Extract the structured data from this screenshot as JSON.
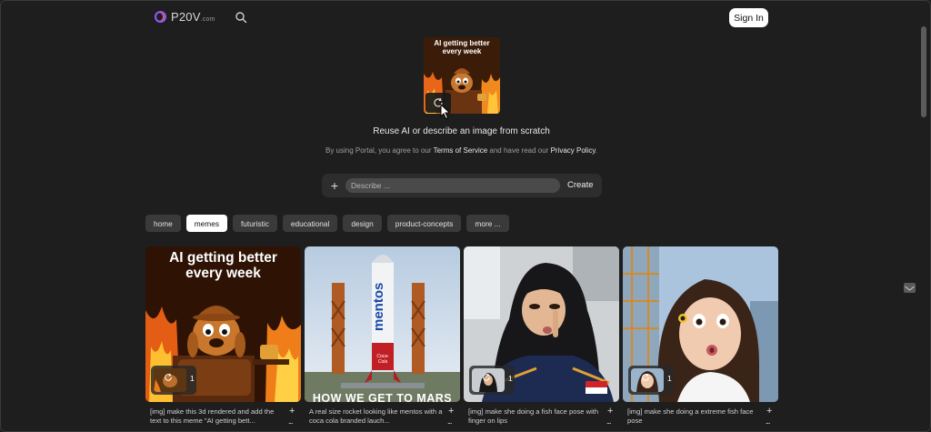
{
  "header": {
    "brand": "P20V",
    "brand_suffix": ".com",
    "sign_in_label": "Sign In"
  },
  "hero": {
    "image_caption": "AI getting better every week",
    "title": "Reuse AI or describe an image from scratch",
    "legal_prefix": "By using Portal, you agree to our ",
    "terms_label": "Terms of Service",
    "legal_middle": " and have read our ",
    "privacy_label": "Privacy Policy",
    "legal_suffix": "."
  },
  "prompt": {
    "plus_label": "+",
    "placeholder": "Describe ...",
    "create_label": "Create"
  },
  "tags": [
    {
      "label": "home",
      "active": false
    },
    {
      "label": "memes",
      "active": true
    },
    {
      "label": "futuristic",
      "active": false
    },
    {
      "label": "educational",
      "active": false
    },
    {
      "label": "design",
      "active": false
    },
    {
      "label": "product-concepts",
      "active": false
    },
    {
      "label": "more ...",
      "active": false
    }
  ],
  "cards": [
    {
      "image_text": "AI getting better every week",
      "ref_count": "1",
      "caption": "[img] make this 3d rendered and add the text to this meme \"AI getting bett...",
      "plus": "+",
      "more": "..."
    },
    {
      "image_text": "HOW WE GET TO MARS",
      "rocket_brand": "mentos",
      "rocket_logo": "Coca-Cola",
      "caption": "A real size rocket looking like mentos with a coca cola branded lauch...",
      "plus": "+",
      "more": "..."
    },
    {
      "ref_count": "1",
      "caption": "[img] make she doing a fish face pose with finger on lips",
      "plus": "+",
      "more": "..."
    },
    {
      "ref_count": "1",
      "caption": "[img] make she doing a extreme fish face pose",
      "plus": "+",
      "more": "..."
    }
  ],
  "colors": {
    "background": "#1e1e1e",
    "accent": "#8d5cf6",
    "active_tag": "#ffffff"
  }
}
